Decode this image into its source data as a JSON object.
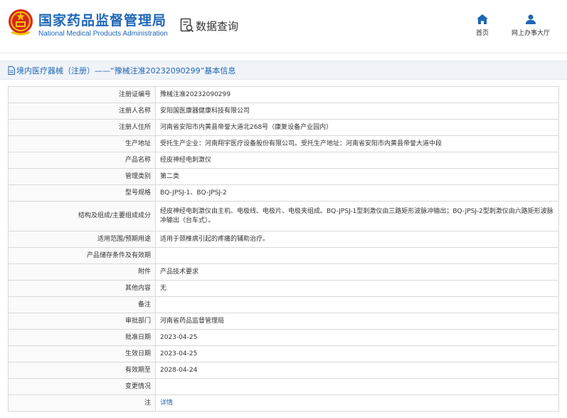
{
  "header": {
    "title_cn": "国家药品监督管理局",
    "title_en": "National Medical Products Administration",
    "query_label": "数据查询",
    "nav": [
      {
        "label": "首页",
        "icon": "home-icon"
      },
      {
        "label": "网上办事大厅",
        "icon": "user-icon"
      }
    ]
  },
  "titlebar": {
    "text": "境内医疗器械（注册）——“豫械注准20232090299”基本信息"
  },
  "rows": [
    {
      "label": "注册证编号",
      "value": "豫械注准20232090299"
    },
    {
      "label": "注册人名称",
      "value": "安阳国医康器健康科技有限公司"
    },
    {
      "label": "注册人住所",
      "value": "河南省安阳市内黄县帝誉大道北268号（康复设备产业园内）"
    },
    {
      "label": "生产地址",
      "value": "受托生产企业：河南翔宇医疗设备股份有限公司。受托生产地址：河南省安阳市内黄县帝誉大道中段"
    },
    {
      "label": "产品名称",
      "value": "经皮神经电刺激仪"
    },
    {
      "label": "管理类别",
      "value": "第二类"
    },
    {
      "label": "型号规格",
      "value": "BQ-JPSJ-1、BQ-JPSJ-2"
    },
    {
      "label": "结构及组成/主要组成成分",
      "value": "经皮神经电刺激仪由主机、电极线、电极片、电极夹组成。BQ-JPSJ-1型刺激仪由三路矩形波脉冲输出；BQ-JPSJ-2型刺激仪由六路矩形波脉冲输出（台车式）。"
    },
    {
      "label": "适用范围/预期用途",
      "value": "适用于颈椎病引起的疼痛的辅助治疗。"
    },
    {
      "label": "产品储存条件及有效期",
      "value": ""
    },
    {
      "label": "附件",
      "value": "产品技术要求"
    },
    {
      "label": "其他内容",
      "value": "无"
    },
    {
      "label": "备注",
      "value": ""
    },
    {
      "label": "审批部门",
      "value": "河南省药品监督管理局"
    },
    {
      "label": "批准日期",
      "value": "2023-04-25"
    },
    {
      "label": "生效日期",
      "value": "2023-04-25"
    },
    {
      "label": "有效期至",
      "value": "2028-04-24"
    },
    {
      "label": "变更情况",
      "value": ""
    },
    {
      "label": "注",
      "value": "详情"
    }
  ],
  "colors": {
    "brand_blue": "#1e66b6",
    "emblem_red": "#d7261e",
    "emblem_gold": "#f2c500"
  }
}
